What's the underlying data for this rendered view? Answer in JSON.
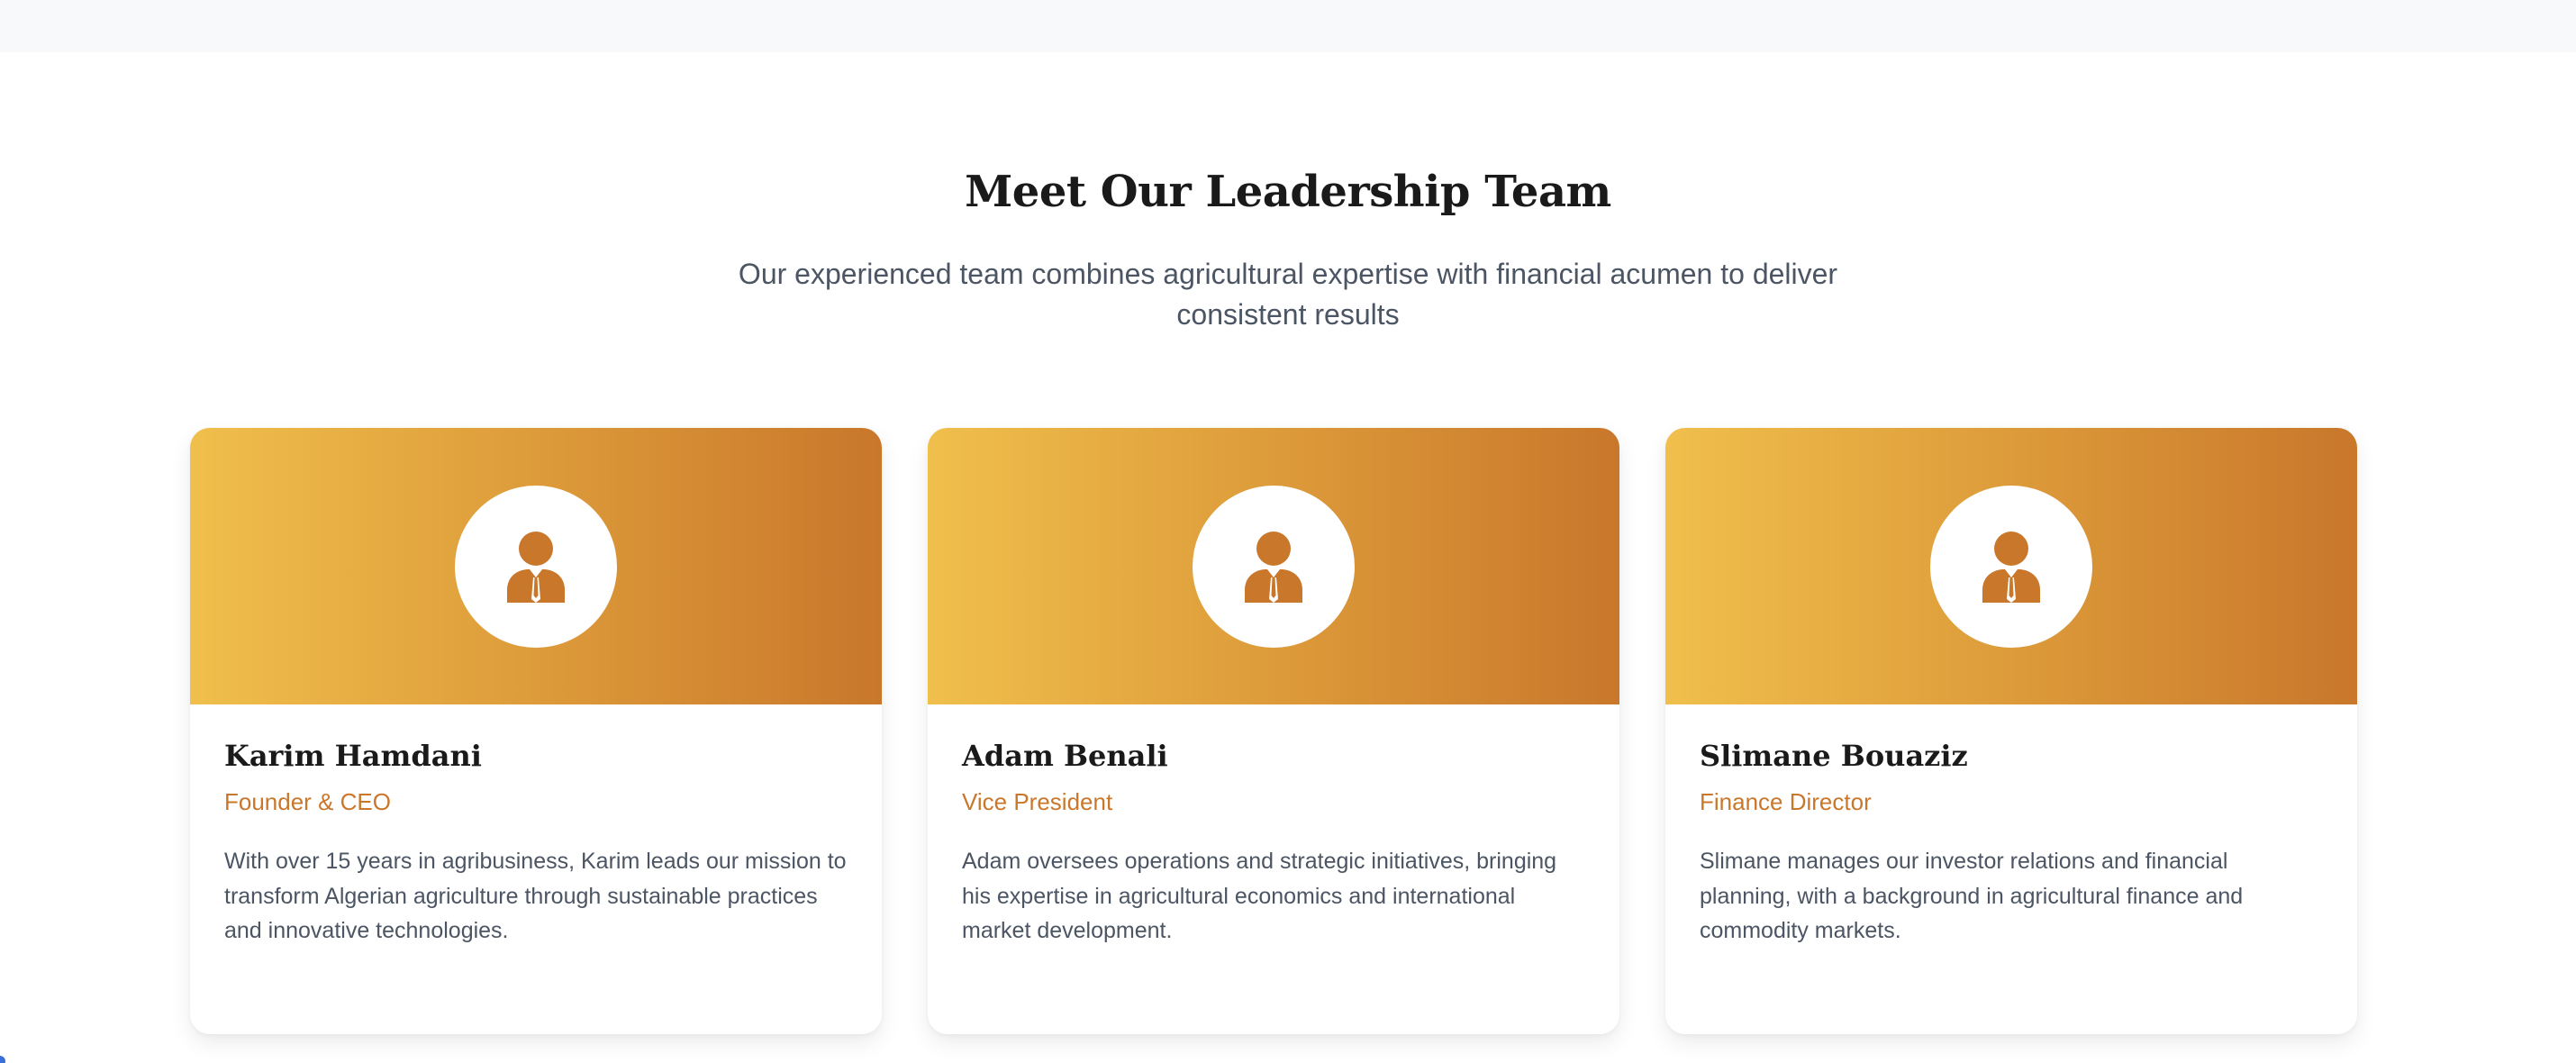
{
  "section": {
    "title": "Meet Our Leadership Team",
    "subtitle": "Our experienced team combines agricultural expertise with financial acumen to deliver consistent results"
  },
  "team": [
    {
      "name": "Karim Hamdani",
      "role": "Founder & CEO",
      "bio": "With over 15 years in agribusiness, Karim leads our mission to transform Algerian agriculture through sustainable practices and innovative technologies.",
      "icon": "user-tie-icon"
    },
    {
      "name": "Adam Benali",
      "role": "Vice President",
      "bio": "Adam oversees operations and strategic initiatives, bringing his expertise in agricultural economics and international market development.",
      "icon": "user-tie-icon"
    },
    {
      "name": "Slimane Bouaziz",
      "role": "Finance Director",
      "bio": "Slimane manages our investor relations and financial planning, with a background in agricultural finance and commodity markets.",
      "icon": "user-tie-icon"
    }
  ],
  "colors": {
    "accent": "#c9772b",
    "gradient_start": "#f0bf4c",
    "gradient_end": "#c9772b",
    "heading": "#1a1a1a",
    "body_text": "#4b5563"
  }
}
